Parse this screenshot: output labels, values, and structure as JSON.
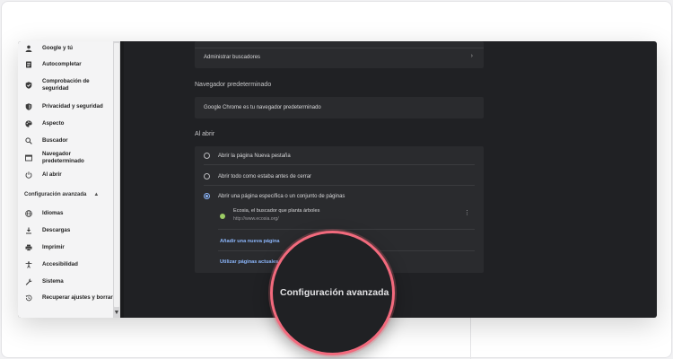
{
  "sidebar": {
    "items": [
      {
        "label": "Google y tú",
        "icon": "person-icon"
      },
      {
        "label": "Autocompletar",
        "icon": "clipboard-icon"
      },
      {
        "label": "Comprobación de seguridad",
        "icon": "shield-check-icon"
      },
      {
        "label": "Privacidad y seguridad",
        "icon": "shield-icon"
      },
      {
        "label": "Aspecto",
        "icon": "palette-icon"
      },
      {
        "label": "Buscador",
        "icon": "search-icon"
      },
      {
        "label": "Navegador predeterminado",
        "icon": "browser-icon"
      },
      {
        "label": "Al abrir",
        "icon": "power-icon"
      }
    ],
    "advanced_label": "Configuración avanzada",
    "advanced_items": [
      {
        "label": "Idiomas",
        "icon": "globe-icon"
      },
      {
        "label": "Descargas",
        "icon": "download-icon"
      },
      {
        "label": "Imprimir",
        "icon": "printer-icon"
      },
      {
        "label": "Accesibilidad",
        "icon": "accessibility-icon"
      },
      {
        "label": "Sistema",
        "icon": "wrench-icon"
      },
      {
        "label": "Recuperar ajustes y borrar",
        "icon": "history-icon"
      }
    ]
  },
  "main": {
    "search_engines_row": "Administrar buscadores",
    "default_browser": {
      "title": "Navegador predeterminado",
      "status": "Google Chrome es tu navegador predeterminado"
    },
    "on_startup": {
      "title": "Al abrir",
      "options": [
        {
          "label": "Abrir la página Nueva pestaña",
          "selected": false
        },
        {
          "label": "Abrir todo como estaba antes de cerrar",
          "selected": false
        },
        {
          "label": "Abrir una página específica o un conjunto de páginas",
          "selected": true
        }
      ],
      "page": {
        "name": "Ecosia, el buscador que planta árboles",
        "url": "http://www.ecosia.org/"
      },
      "add_page": "Añadir una nueva página",
      "use_current": "Utilizar páginas actuales"
    }
  },
  "magnifier": {
    "label": "Configuración avanzada"
  },
  "colors": {
    "accent": "#8ab4f8",
    "highlight_ring": "#f26a7d",
    "background_dark": "#202124"
  }
}
